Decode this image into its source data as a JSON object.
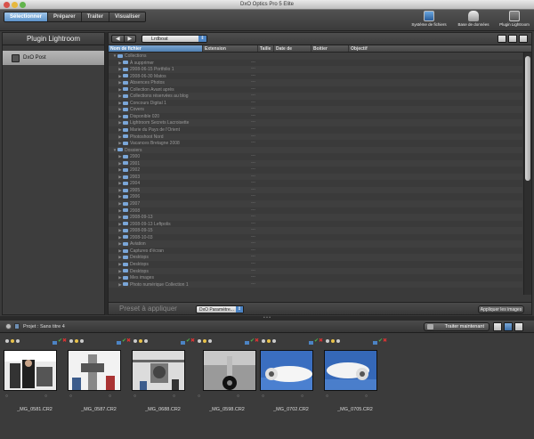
{
  "window": {
    "title": "DxO Optics Pro 5 Elite"
  },
  "modes": [
    {
      "label": "Sélectionner",
      "active": true
    },
    {
      "label": "Préparer",
      "active": false
    },
    {
      "label": "Traiter",
      "active": false
    },
    {
      "label": "Visualiser",
      "active": false
    }
  ],
  "toolbar_icons": [
    {
      "label": "Système de fichiers",
      "icon": "monitor-icon"
    },
    {
      "label": "Base de données",
      "icon": "database-icon"
    },
    {
      "label": "Plugin Lightroom",
      "icon": "lightroom-icon"
    }
  ],
  "left_panel": {
    "title": "Plugin Lightroom",
    "item": "DxO Post"
  },
  "browser": {
    "folder": "Lrdboat",
    "columns": [
      "Nom de fichier",
      "Extension",
      "Taille",
      "Date de",
      "Boitier",
      "Objectif"
    ],
    "rows": [
      {
        "text": "Collections",
        "level": 0,
        "open": true
      },
      {
        "text": "À supprimer",
        "level": 1
      },
      {
        "text": "2008-06-15 Portfolio 1",
        "level": 1
      },
      {
        "text": "2008-06-30 Matos",
        "level": 1
      },
      {
        "text": "Absences Photos",
        "level": 1
      },
      {
        "text": "Collection Avant après",
        "level": 1
      },
      {
        "text": "Collections réservées au blog",
        "level": 1
      },
      {
        "text": "Concours Digital 1",
        "level": 1
      },
      {
        "text": "Covers",
        "level": 1
      },
      {
        "text": "Disponible 020",
        "level": 1
      },
      {
        "text": "Lightroom Secrets Lacroisette",
        "level": 1
      },
      {
        "text": "Marie du Pays de l'Orient",
        "level": 1
      },
      {
        "text": "Photoshoot Nord",
        "level": 1
      },
      {
        "text": "Vacances Bretagne 2008",
        "level": 1
      },
      {
        "text": "Dossiers",
        "level": 0,
        "open": true
      },
      {
        "text": "2000",
        "level": 1
      },
      {
        "text": "2001",
        "level": 1
      },
      {
        "text": "2002",
        "level": 1
      },
      {
        "text": "2003",
        "level": 1
      },
      {
        "text": "2004",
        "level": 1
      },
      {
        "text": "2005",
        "level": 1
      },
      {
        "text": "2006",
        "level": 1
      },
      {
        "text": "2007",
        "level": 1
      },
      {
        "text": "2008",
        "level": 1
      },
      {
        "text": "2008-09-13",
        "level": 1
      },
      {
        "text": "2008-09-13 Leftpolis",
        "level": 1
      },
      {
        "text": "2008-09-15",
        "level": 1
      },
      {
        "text": "2008-10-03",
        "level": 1
      },
      {
        "text": "Aviation",
        "level": 1
      },
      {
        "text": "Captures d'écran",
        "level": 1
      },
      {
        "text": "Desktops",
        "level": 1
      },
      {
        "text": "Desktops",
        "level": 1
      },
      {
        "text": "Desktops",
        "level": 1
      },
      {
        "text": "Mes images",
        "level": 1
      },
      {
        "text": "Photo numérique Collection 1",
        "level": 1
      }
    ],
    "dash": "---"
  },
  "preset": {
    "label": "Preset à appliquer",
    "value": "DxO Paramètre...",
    "apply": "Appliquer les images"
  },
  "project": {
    "name": "Projet : Sans titre 4",
    "process": "Traiter maintenant"
  },
  "thumbnails": [
    {
      "name": "_MG_0581.CR2",
      "scene": "workshop"
    },
    {
      "name": "_MG_0587.CR2",
      "scene": "engine"
    },
    {
      "name": "_MG_0688.CR2",
      "scene": "rotor"
    },
    {
      "name": "_MG_0598.CR2",
      "scene": "gear"
    },
    {
      "name": "_MG_0702.CR2",
      "scene": "plane"
    },
    {
      "name": "_MG_0705.CR2",
      "scene": "plane2"
    }
  ],
  "colors": {
    "accent": "#5d93c9",
    "check": "#4db14d",
    "reject": "#d33333"
  }
}
